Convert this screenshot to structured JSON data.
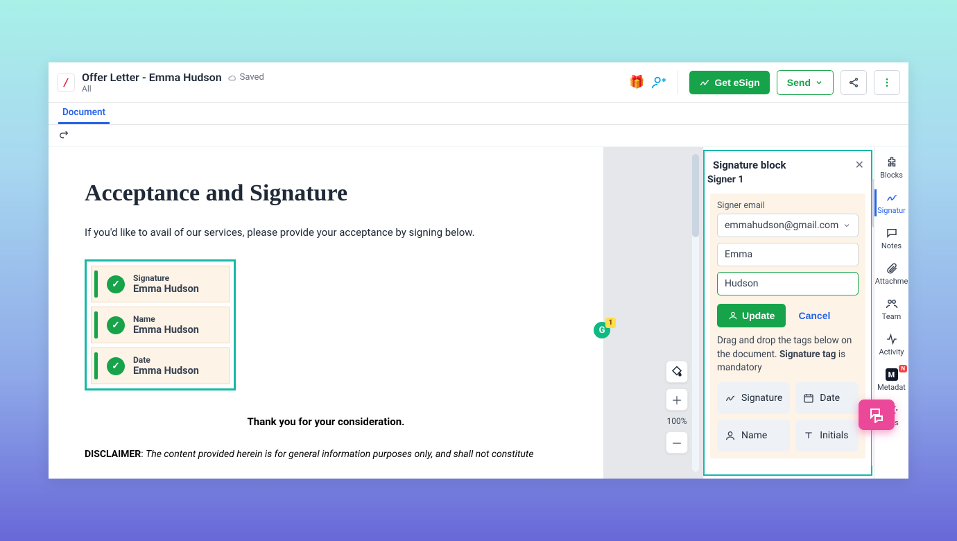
{
  "header": {
    "logo_glyph": "/",
    "title": "Offer Letter - Emma Hudson",
    "saved_label": "Saved",
    "subtitle": "All",
    "get_esign_label": "Get eSign",
    "send_label": "Send"
  },
  "tabs": {
    "document": "Document"
  },
  "canvas": {
    "zoom_label": "100%"
  },
  "document": {
    "heading": "Acceptance and Signature",
    "intro": "If you'd like to avail of our services, please provide your acceptance by signing below.",
    "sig_items": [
      {
        "label": "Signature",
        "value": "Emma Hudson"
      },
      {
        "label": "Name",
        "value": "Emma Hudson"
      },
      {
        "label": "Date",
        "value": "Emma Hudson"
      }
    ],
    "thankyou": "Thank you for your consideration.",
    "disclaimer_title": "DISCLAIMER",
    "disclaimer_sep": ": ",
    "disclaimer_body": "The content provided herein is for general information purposes only, and shall not constitute"
  },
  "grammarly": {
    "glyph": "G",
    "count": "1"
  },
  "panel": {
    "title": "Signature block",
    "signer_head": "Signer 1",
    "email_label": "Signer email",
    "email_value": "emmahudson@gmail.com",
    "first_name": "Emma",
    "last_name": "Hudson",
    "update_label": "Update",
    "cancel_label": "Cancel",
    "hint_pre": "Drag and drop the tags below on the document. ",
    "hint_bold": "Signature tag",
    "hint_post": " is mandatory",
    "tags": {
      "signature": "Signature",
      "date": "Date",
      "name": "Name",
      "initials": "Initials"
    }
  },
  "rail": {
    "blocks": "Blocks",
    "signatures": "Signatur",
    "notes": "Notes",
    "attachments": "Attachme",
    "team": "Team",
    "activity": "Activity",
    "metadata": "Metadat",
    "settings": "ings",
    "new_badge": "N"
  }
}
